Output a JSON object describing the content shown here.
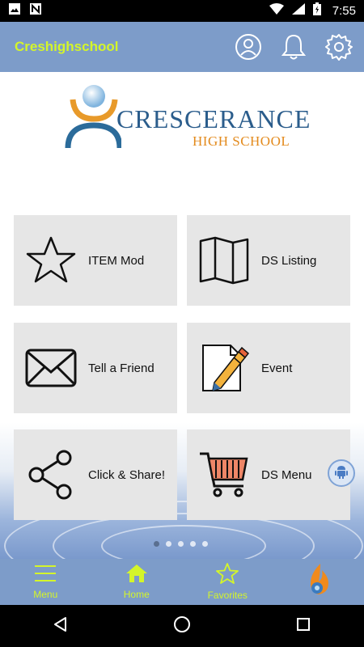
{
  "status_bar": {
    "time": "7:55"
  },
  "header": {
    "title": "Creshighschool"
  },
  "logo": {
    "name_main": "CRESCERANCE",
    "name_sub": "HIGH SCHOOL"
  },
  "tiles": [
    {
      "label": "ITEM Mod",
      "icon": "star-icon"
    },
    {
      "label": "DS Listing",
      "icon": "map-icon"
    },
    {
      "label": "Tell a Friend",
      "icon": "envelope-icon"
    },
    {
      "label": "Event",
      "icon": "pencil-paper-icon"
    },
    {
      "label": "Click & Share!",
      "icon": "share-icon"
    },
    {
      "label": "DS Menu",
      "icon": "cart-icon"
    }
  ],
  "pager": {
    "pages": 5,
    "active": 1
  },
  "bottom_nav": [
    {
      "label": "Menu",
      "icon": "hamburger-icon"
    },
    {
      "label": "Home",
      "icon": "home-icon"
    },
    {
      "label": "Favorites",
      "icon": "star-outline-icon"
    },
    {
      "label": "",
      "icon": "brand-drop-icon"
    }
  ],
  "colors": {
    "header_bg": "#7d9cc9",
    "accent": "#d4f52a",
    "tile_bg": "#e6e6e6"
  }
}
